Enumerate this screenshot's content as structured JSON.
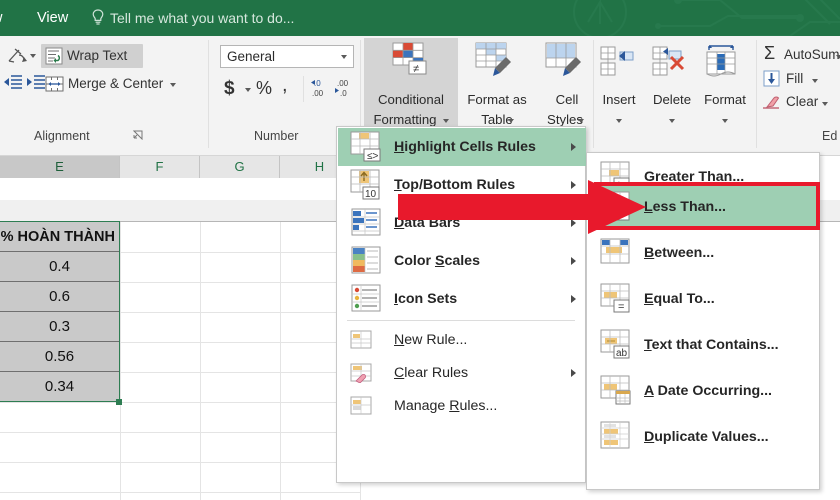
{
  "titlebar": {
    "tabs": [
      {
        "label": "w",
        "name": "tab-review"
      },
      {
        "label": "View",
        "name": "tab-view"
      }
    ],
    "tellme_placeholder": "Tell me what you want to do...",
    "bulb_icon": "lightbulb-icon",
    "bg_color": "#217346"
  },
  "ribbon": {
    "alignment": {
      "group_label": "Alignment",
      "orientation_label": "",
      "orientation_icon": "text-orientation-icon",
      "decrease_indent_icon": "decrease-indent-icon",
      "increase_indent_icon": "increase-indent-icon",
      "wrap_text": "Wrap Text",
      "wrap_text_icon": "wrap-text-icon",
      "merge_center": "Merge & Center",
      "merge_center_icon": "merge-center-icon"
    },
    "number": {
      "group_label": "Number",
      "format_value": "General",
      "currency_icon": "currency-icon",
      "percent_icon": "percent-icon",
      "comma_icon": "comma-style-icon",
      "increase_decimal": ".0\n.00",
      "decrease_decimal": ".00\n.0"
    },
    "styles": {
      "conditional_formatting_line1": "Conditional",
      "conditional_formatting_line2": "Formatting",
      "conditional_formatting_icon": "conditional-formatting-icon",
      "format_as_table_line1": "Format as",
      "format_as_table_line2": "Table",
      "format_as_table_icon": "format-as-table-icon",
      "cell_styles_line1": "Cell",
      "cell_styles_line2": "Styles",
      "cell_styles_icon": "cell-styles-icon"
    },
    "cells": {
      "insert": "Insert",
      "insert_icon": "insert-cells-icon",
      "delete": "Delete",
      "delete_icon": "delete-cells-icon",
      "format": "Format",
      "format_icon": "format-cells-icon"
    },
    "editing": {
      "autosum": "AutoSum",
      "autosum_icon": "sigma-icon",
      "fill": "Fill",
      "fill_icon": "fill-down-icon",
      "clear": "Clear",
      "clear_icon": "eraser-icon",
      "group_label": "Ed"
    }
  },
  "sheet": {
    "column_headers": [
      "E",
      "F",
      "G",
      "H"
    ],
    "selected_column": "E",
    "cells": [
      {
        "text": "% HOÀN THÀNH",
        "header": true
      },
      {
        "text": "0.4",
        "header": false
      },
      {
        "text": "0.6",
        "header": false
      },
      {
        "text": "0.3",
        "header": false
      },
      {
        "text": "0.56",
        "header": false
      },
      {
        "text": "0.34",
        "header": false
      }
    ],
    "selection_color": "#2e7d52"
  },
  "menu_main": {
    "name": "conditional-formatting-menu",
    "items": [
      {
        "label": "Highlight Cells Rules",
        "accel": "H",
        "icon": "highlight-cells-rules-icon",
        "submenu": true,
        "highlighted": true,
        "bold": true,
        "separator_after": false
      },
      {
        "label": "Top/Bottom Rules",
        "accel": "T",
        "icon": "top-bottom-rules-icon",
        "submenu": true,
        "highlighted": false,
        "bold": true,
        "separator_after": false
      },
      {
        "label": "Data Bars",
        "accel": "D",
        "icon": "data-bars-icon",
        "submenu": true,
        "highlighted": false,
        "bold": true,
        "separator_after": false
      },
      {
        "label": "Color Scales",
        "accel": "S",
        "icon": "color-scales-icon",
        "submenu": true,
        "highlighted": false,
        "bold": true,
        "separator_after": false
      },
      {
        "label": "Icon Sets",
        "accel": "I",
        "icon": "icon-sets-icon",
        "submenu": true,
        "highlighted": false,
        "bold": true,
        "separator_after": true
      },
      {
        "label": "New Rule...",
        "accel": "N",
        "icon": "new-rule-icon",
        "submenu": false,
        "highlighted": false,
        "bold": false,
        "separator_after": false
      },
      {
        "label": "Clear Rules",
        "accel": "C",
        "icon": "clear-rules-icon",
        "submenu": true,
        "highlighted": false,
        "bold": false,
        "separator_after": false
      },
      {
        "label": "Manage Rules...",
        "accel": "R",
        "icon": "manage-rules-icon",
        "submenu": false,
        "highlighted": false,
        "bold": false,
        "separator_after": false
      }
    ]
  },
  "menu_sub": {
    "name": "highlight-cells-rules-submenu",
    "items": [
      {
        "label": "Greater Than...",
        "icon": "greater-than-icon",
        "highlighted": false,
        "op": ">"
      },
      {
        "label": "Less Than...",
        "icon": "less-than-icon",
        "highlighted": true,
        "op": "<"
      },
      {
        "label": "Between...",
        "icon": "between-icon",
        "highlighted": false,
        "op": ""
      },
      {
        "label": "Equal To...",
        "icon": "equal-to-icon",
        "highlighted": false,
        "op": "="
      },
      {
        "label": "Text that Contains...",
        "icon": "text-contains-icon",
        "highlighted": false,
        "op": "ab"
      },
      {
        "label": "A Date Occurring...",
        "icon": "date-occurring-icon",
        "highlighted": false,
        "op": ""
      },
      {
        "label": "Duplicate Values...",
        "icon": "duplicate-values-icon",
        "highlighted": false,
        "op": ""
      }
    ]
  },
  "annotations": {
    "arrow_color": "#e8192c",
    "highlight_box_color": "#e8192c",
    "highlight_green": "#9ecfb3",
    "arrow_name": "red-pointer-arrow",
    "box_name": "red-highlight-box"
  }
}
